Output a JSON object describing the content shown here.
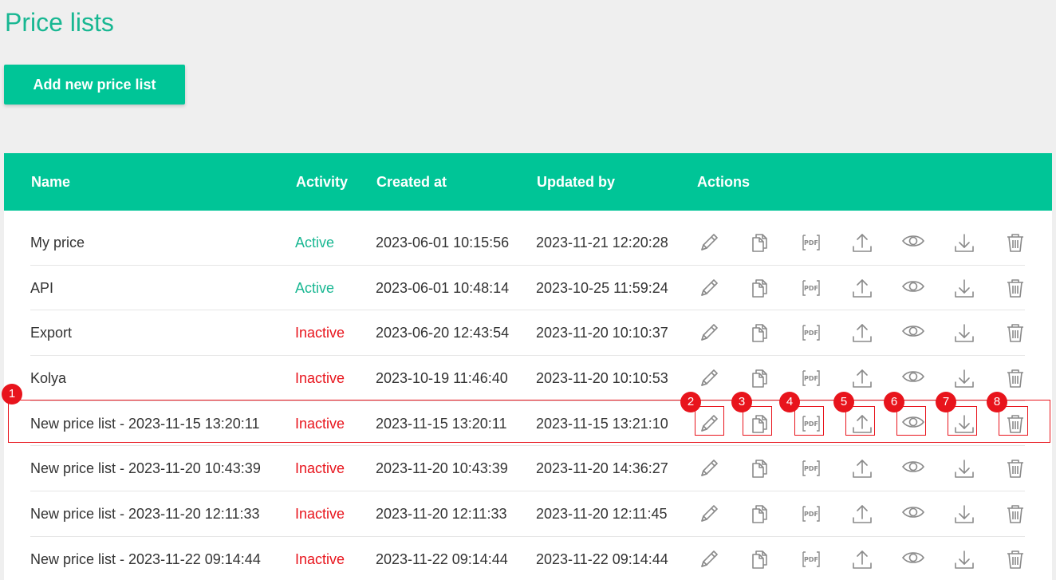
{
  "page": {
    "title": "Price lists",
    "add_button_label": "Add new price list"
  },
  "table": {
    "headers": {
      "name": "Name",
      "activity": "Activity",
      "created_at": "Created at",
      "updated_by": "Updated by",
      "actions": "Actions"
    },
    "rows": [
      {
        "name": "My price",
        "activity": "Active",
        "created": "2023-06-01 10:15:56",
        "updated": "2023-11-21 12:20:28"
      },
      {
        "name": "API",
        "activity": "Active",
        "created": "2023-06-01 10:48:14",
        "updated": "2023-10-25 11:59:24"
      },
      {
        "name": "Export",
        "activity": "Inactive",
        "created": "2023-06-20 12:43:54",
        "updated": "2023-11-20 10:10:37"
      },
      {
        "name": "Kolya",
        "activity": "Inactive",
        "created": "2023-10-19 11:46:40",
        "updated": "2023-11-20 10:10:53"
      },
      {
        "name": "New price list - 2023-11-15 13:20:11",
        "activity": "Inactive",
        "created": "2023-11-15 13:20:11",
        "updated": "2023-11-15 13:21:10"
      },
      {
        "name": "New price list - 2023-11-20 10:43:39",
        "activity": "Inactive",
        "created": "2023-11-20 10:43:39",
        "updated": "2023-11-20 14:36:27"
      },
      {
        "name": "New price list - 2023-11-20 12:11:33",
        "activity": "Inactive",
        "created": "2023-11-20 12:11:33",
        "updated": "2023-11-20 12:11:45"
      },
      {
        "name": "New price list - 2023-11-22 09:14:44",
        "activity": "Inactive",
        "created": "2023-11-22 09:14:44",
        "updated": "2023-11-22 09:14:44"
      }
    ],
    "action_icons": [
      "pencil-icon",
      "copy-icon",
      "pdf-icon",
      "upload-icon",
      "eye-icon",
      "download-icon",
      "trash-icon"
    ]
  },
  "annotations": {
    "badges": [
      "1",
      "2",
      "3",
      "4",
      "5",
      "6",
      "7",
      "8"
    ],
    "pdf_icon_text": "PDF"
  },
  "colors": {
    "accent": "#00c597",
    "title": "#18b792",
    "active": "#18b792",
    "inactive": "#e8141c",
    "annotation": "#e8141c",
    "icon": "#8a8a8a"
  }
}
